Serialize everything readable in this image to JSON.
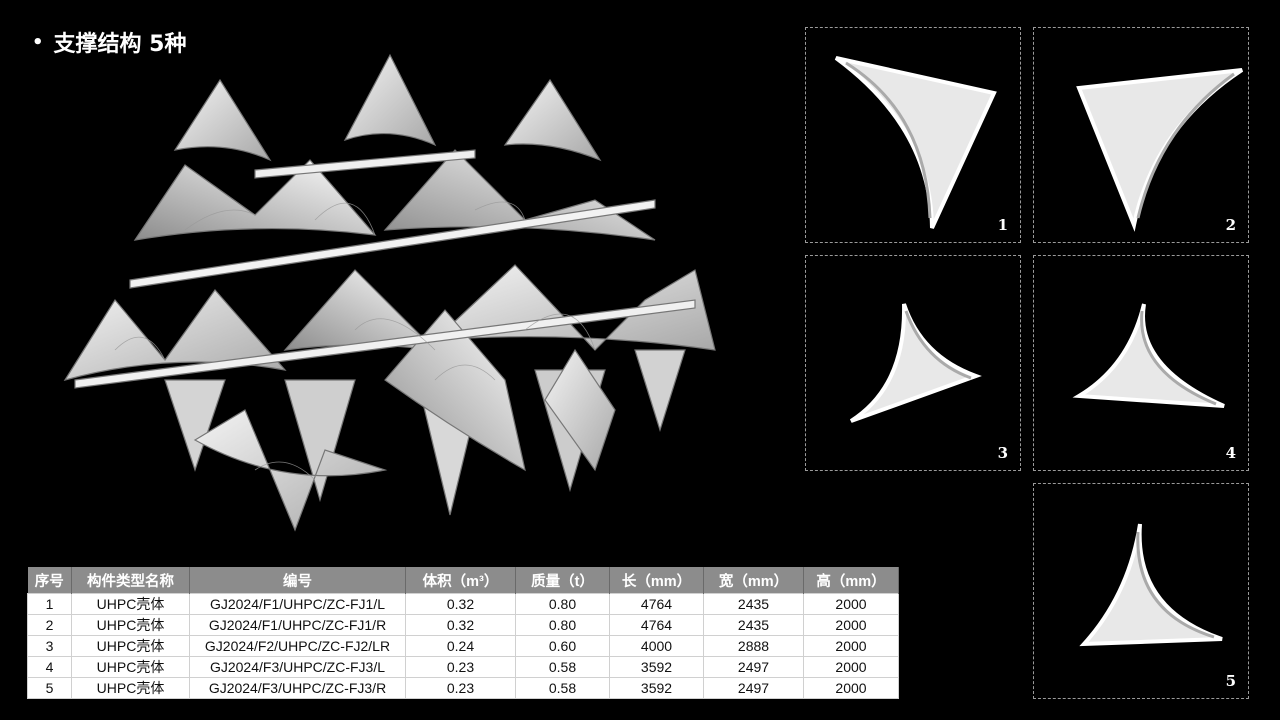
{
  "title": "支撑结构 5种",
  "panels": [
    {
      "number": "1"
    },
    {
      "number": "2"
    },
    {
      "number": "3"
    },
    {
      "number": "4"
    },
    {
      "number": "5"
    }
  ],
  "table": {
    "headers": [
      "序号",
      "构件类型名称",
      "编号",
      "体积（m³）",
      "质量（t）",
      "长（mm）",
      "宽（mm）",
      "高（mm）"
    ],
    "rows": [
      [
        "1",
        "UHPC壳体",
        "GJ2024/F1/UHPC/ZC-FJ1/L",
        "0.32",
        "0.80",
        "4764",
        "2435",
        "2000"
      ],
      [
        "2",
        "UHPC壳体",
        "GJ2024/F1/UHPC/ZC-FJ1/R",
        "0.32",
        "0.80",
        "4764",
        "2435",
        "2000"
      ],
      [
        "3",
        "UHPC壳体",
        "GJ2024/F2/UHPC/ZC-FJ2/LR",
        "0.24",
        "0.60",
        "4000",
        "2888",
        "2000"
      ],
      [
        "4",
        "UHPC壳体",
        "GJ2024/F3/UHPC/ZC-FJ3/L",
        "0.23",
        "0.58",
        "3592",
        "2497",
        "2000"
      ],
      [
        "5",
        "UHPC壳体",
        "GJ2024/F3/UHPC/ZC-FJ3/R",
        "0.23",
        "0.58",
        "3592",
        "2497",
        "2000"
      ]
    ]
  },
  "colors": {
    "background": "#000000",
    "header_bg": "#8c8c8c",
    "shell": "#e6e6e6"
  }
}
